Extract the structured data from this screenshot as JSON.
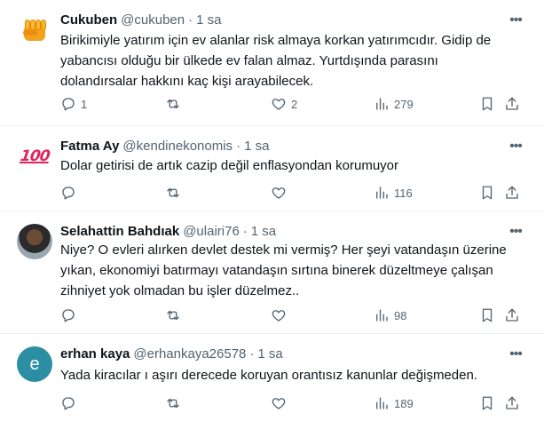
{
  "tweets": [
    {
      "avatar": "fist-emoji",
      "name": "Cukuben",
      "handle": "@cukuben",
      "time": "1 sa",
      "text": "Birikimiyle yatırım için ev alanlar risk almaya korkan yatırımcıdır. Gidip de\nyabancısı olduğu bir ülkede ev falan almaz. Yurtdışında parasını\ndolandırsalar hakkını kaç kişi arayabilecek.",
      "replies": "1",
      "retweets": "",
      "likes": "2",
      "views": "279"
    },
    {
      "avatar": "hundred-points-emoji",
      "name": "Fatma Ay",
      "handle": "@kendinekonomis",
      "time": "1 sa",
      "text": "Dolar getirisi de artık cazip değil enflasyondan korumuyor",
      "replies": "",
      "retweets": "",
      "likes": "",
      "views": "116"
    },
    {
      "avatar": "user-photo",
      "name": "Selahattin Bahdıak",
      "handle": "@ulairi76",
      "time": "1 sa",
      "text": "Niye? O evleri alırken devlet destek mi vermiş? Her şeyi vatandaşın üzerine\nyıkan, ekonomiyi batırmayı vatandaşın sırtına binerek düzeltmeye çalışan\nzihniyet yok olmadan bu işler düzelmez..",
      "replies": "",
      "retweets": "",
      "likes": "",
      "views": "98"
    },
    {
      "avatar": "letter-e",
      "avatar_letter": "e",
      "name": "erhan kaya",
      "handle": "@erhankaya26578",
      "time": "1 sa",
      "text": "Yada kiracılar ı aşırı derecede koruyan orantısız kanunlar değişmeden.",
      "replies": "",
      "retweets": "",
      "likes": "",
      "views": "189"
    }
  ],
  "separator": "·",
  "more_icon": "more-icon",
  "colors": {
    "text": "#0f1419",
    "muted": "#536471",
    "divider": "#eff3f4",
    "avatar_letter_bg": "#2b8ea3"
  }
}
